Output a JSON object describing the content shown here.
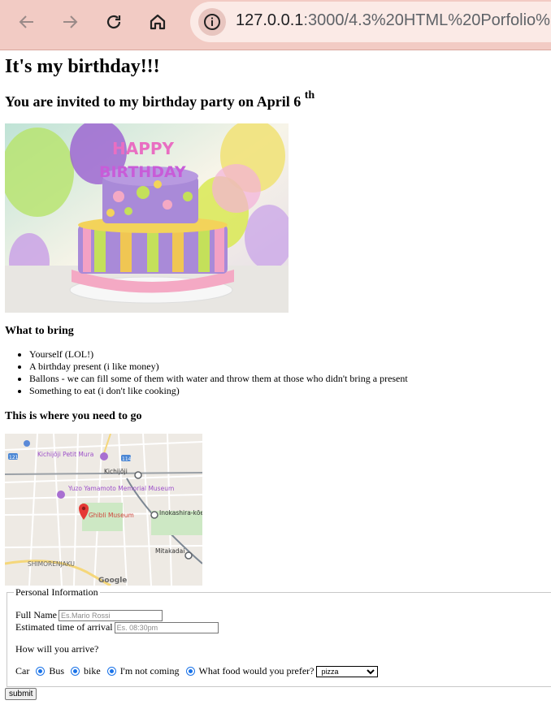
{
  "browser": {
    "url_host": "127.0.0.1",
    "url_path": ":3000/4.3%20HTML%20Porfolio%",
    "icons": [
      "back-icon",
      "forward-icon",
      "reload-icon",
      "home-icon",
      "site-info-icon"
    ]
  },
  "page": {
    "title": "It's my birthday!!!",
    "invite_text": "You are invited to my birthday party on April 6",
    "invite_sup": "th",
    "cake_image": {
      "candle_text_1": "HAPPY",
      "candle_text_2": "BIRTHDAY"
    },
    "bring_heading": "What to bring",
    "bring_items": [
      "Yourself (LOL!)",
      "A birthday present (i like money)",
      "Ballons - we can fill some of them with water and throw them at those who didn't bring a present",
      "Something to eat (i don't like cooking)"
    ],
    "where_heading": "This is where you need to go",
    "map": {
      "labels": [
        "Kichijōji Petit Mura",
        "Kichijōji",
        "Yuzo Yamamoto Memorial Museum",
        "Ghibli Museum",
        "Inokashira-kōen",
        "Mitakadai",
        "SHIMORENJAKU",
        "Google",
        "121",
        "114"
      ]
    },
    "form": {
      "legend": "Personal Information",
      "full_name_label": "Full Name",
      "full_name_placeholder": "Es.Mario Rossi",
      "arrival_label": "Estimated time of arrival",
      "arrival_placeholder": "Es. 08:30pm",
      "arrive_question": "How will you arrive?",
      "options": [
        "Car",
        "Bus",
        "bike",
        "I'm not coming"
      ],
      "food_label": "What food would you prefer?",
      "food_selected": "pizza",
      "submit_label": "submit"
    }
  }
}
